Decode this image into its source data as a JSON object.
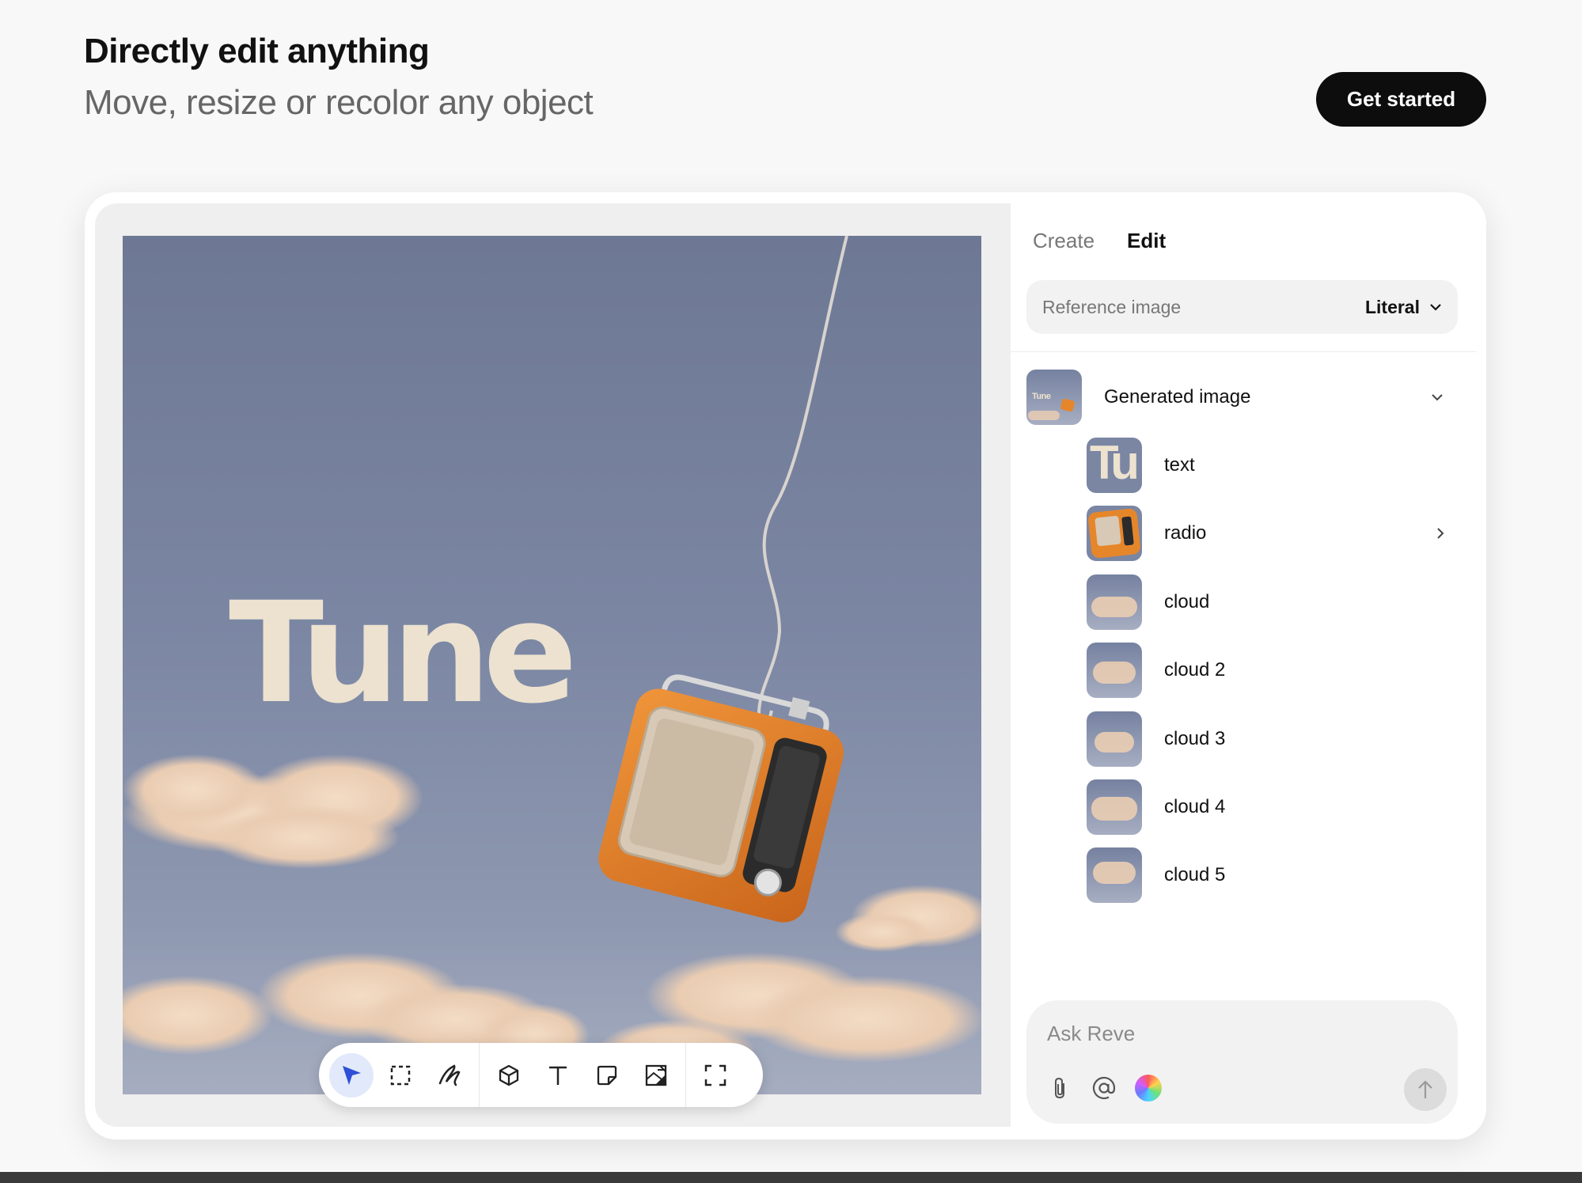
{
  "hero": {
    "title": "Directly edit anything",
    "subtitle": "Move, resize or recolor any object",
    "cta_label": "Get started"
  },
  "artwork": {
    "text": "Tune"
  },
  "toolbar": {
    "tools": [
      "select-arrow-icon",
      "marquee-select-icon",
      "brush-icon",
      "3d-object-icon",
      "text-tool-icon",
      "sticker-icon",
      "image-placeholder-icon",
      "fit-screen-icon"
    ],
    "active_tool": "select-arrow-icon"
  },
  "panel": {
    "tabs": [
      {
        "label": "Create",
        "active": false
      },
      {
        "label": "Edit",
        "active": true
      }
    ],
    "reference": {
      "label": "Reference image",
      "mode": "Literal"
    },
    "generated": {
      "label": "Generated image",
      "thumb_text": "Tune"
    },
    "layers": [
      {
        "label": "text",
        "has_children": false
      },
      {
        "label": "radio",
        "has_children": true
      },
      {
        "label": "cloud",
        "has_children": false
      },
      {
        "label": "cloud 2",
        "has_children": false
      },
      {
        "label": "cloud 3",
        "has_children": false
      },
      {
        "label": "cloud 4",
        "has_children": false
      },
      {
        "label": "cloud 5",
        "has_children": false
      }
    ],
    "ask": {
      "placeholder": "Ask Reve"
    }
  },
  "colors": {
    "accent": "#2f4fd6",
    "cta_bg": "#0d0d0d",
    "radio_orange": "#e6862a",
    "art_text": "#ece2cf"
  }
}
